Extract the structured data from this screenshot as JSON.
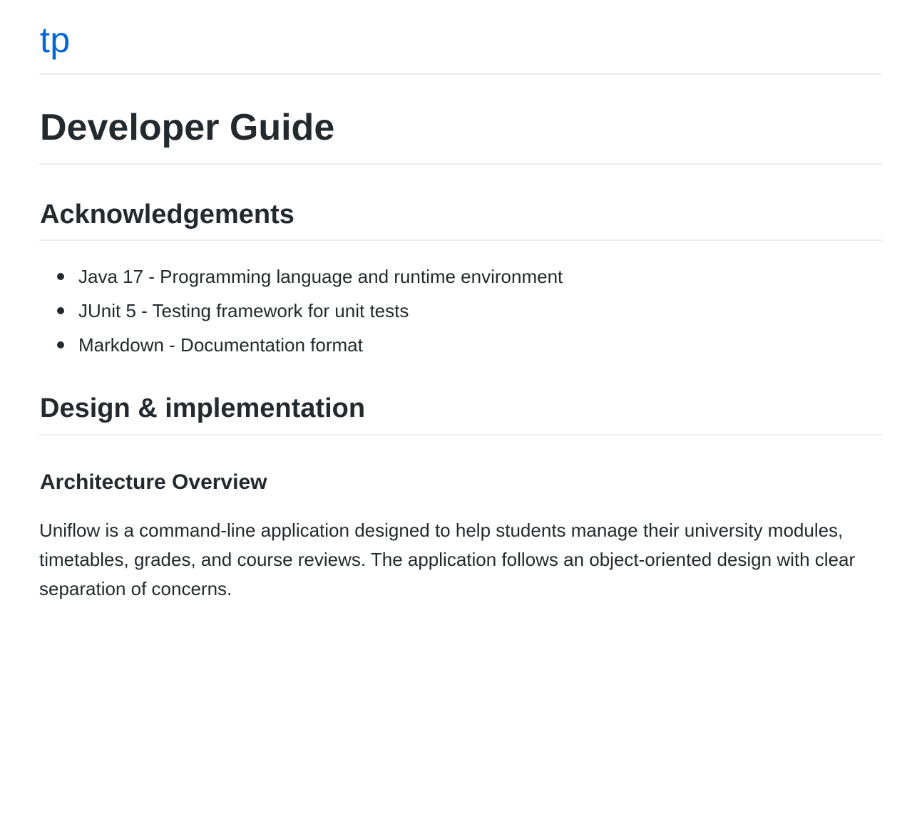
{
  "header": {
    "site_title": "tp"
  },
  "main": {
    "page_title": "Developer Guide",
    "sections": [
      {
        "heading": "Acknowledgements",
        "items": [
          "Java 17 - Programming language and runtime environment",
          "JUnit 5 - Testing framework for unit tests",
          "Markdown - Documentation format"
        ]
      },
      {
        "heading": "Design & implementation",
        "subsections": [
          {
            "heading": "Architecture Overview",
            "paragraph": "Uniflow is a command-line application designed to help students manage their university modules, timetables, grades, and course reviews. The application follows an object-oriented design with clear separation of concerns."
          }
        ]
      }
    ]
  },
  "colors": {
    "link": "#0366d6",
    "text": "#24292e",
    "rule": "#eaecef"
  }
}
